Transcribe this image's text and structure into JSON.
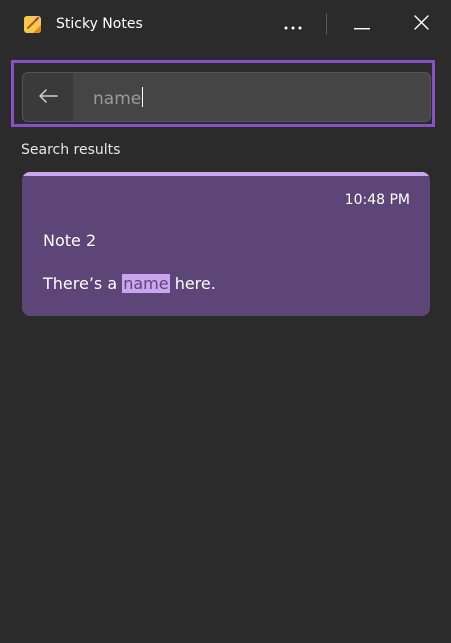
{
  "app": {
    "title": "Sticky Notes",
    "icon": "sticky-notes-app-icon",
    "colors": {
      "background": "#2b2b2b",
      "highlight_border": "#8b4fc7",
      "note_background": "#5e4577",
      "note_accent": "#c9a6ee"
    }
  },
  "titlebar": {
    "more_icon": "more-horizontal-icon",
    "minimize_icon": "minimize-icon",
    "close_icon": "close-icon"
  },
  "search": {
    "back_icon": "arrow-left-icon",
    "value": "name"
  },
  "results": {
    "label": "Search results",
    "notes": [
      {
        "time": "10:48 PM",
        "title": "Note 2",
        "body_before": "There’s a ",
        "body_match": "name",
        "body_after": " here."
      }
    ]
  }
}
